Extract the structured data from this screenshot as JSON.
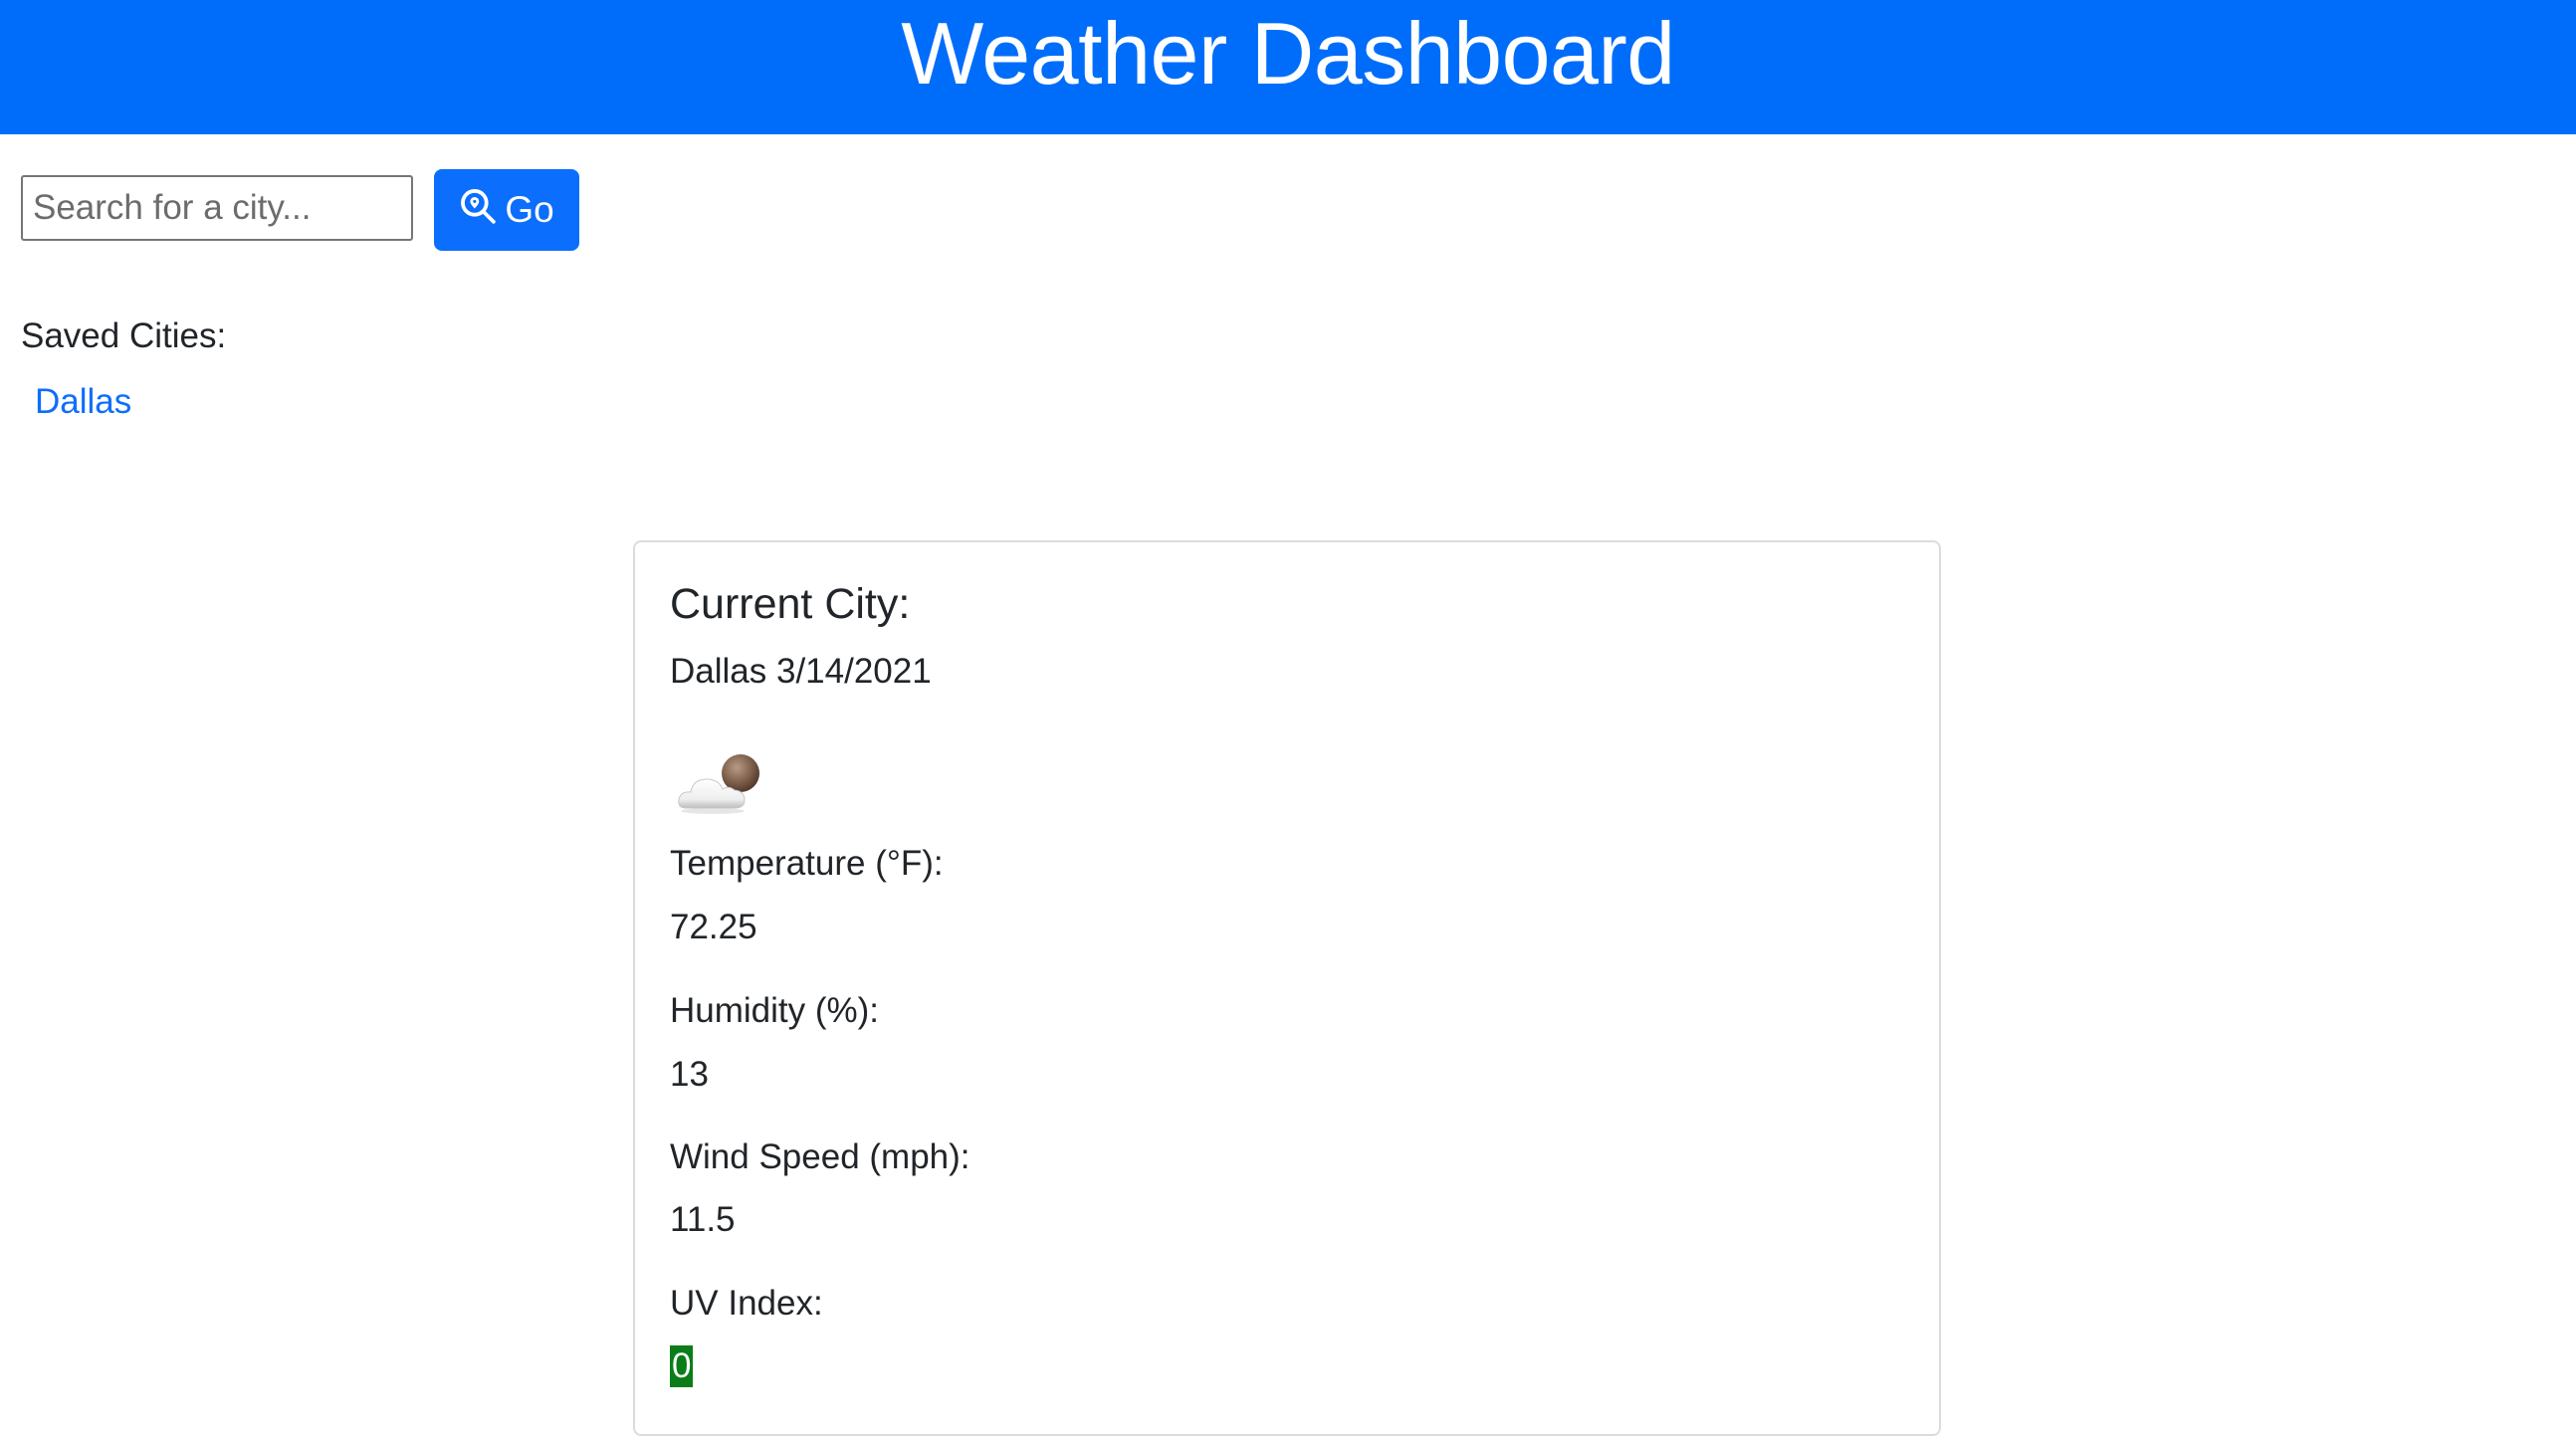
{
  "header": {
    "title": "Weather Dashboard",
    "background_color": "#006dfa"
  },
  "search": {
    "placeholder": "Search for a city...",
    "value": "",
    "button_label": "Go",
    "button_icon": "search-location-icon",
    "button_color": "#0b6efd"
  },
  "saved_cities": {
    "label": "Saved Cities:",
    "items": [
      "Dallas"
    ]
  },
  "current": {
    "title": "Current City:",
    "city_date": "Dallas 3/14/2021",
    "weather_icon": "cloudy-night-icon",
    "temperature_label": "Temperature (°F):",
    "temperature_value": "72.25",
    "humidity_label": "Humidity (%):",
    "humidity_value": "13",
    "wind_label": "Wind Speed (mph):",
    "wind_value": "11.5",
    "uv_label": "UV Index:",
    "uv_value": "0",
    "uv_color": "#0a7d19"
  }
}
